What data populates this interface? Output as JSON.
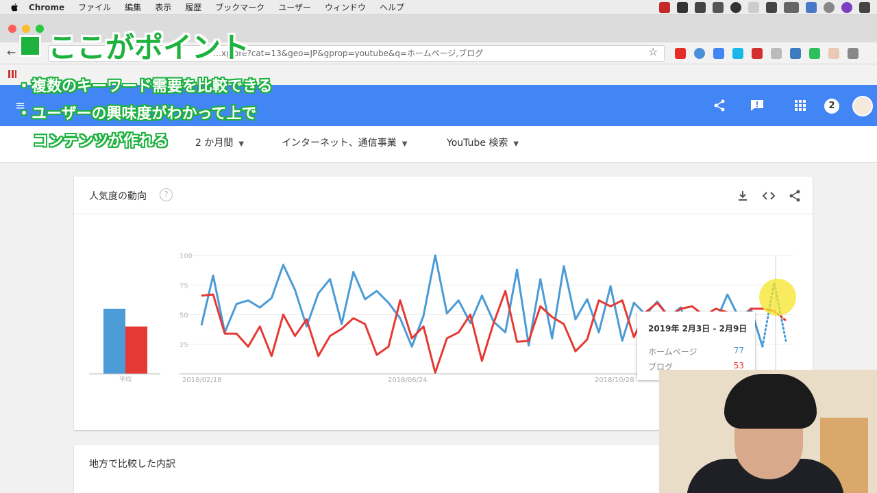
{
  "menubar": {
    "app": "Chrome",
    "items": [
      "ファイル",
      "編集",
      "表示",
      "履歴",
      "ブックマーク",
      "ユーザー",
      "ウィンドウ",
      "ヘルプ"
    ]
  },
  "browser": {
    "url": "…xplore?cat=13&geo=JP&gprop=youtube&q=ホームページ,ブログ"
  },
  "filters": [
    {
      "label": "2 か月間"
    },
    {
      "label": "インターネット、通信事業"
    },
    {
      "label": "YouTube 検索"
    }
  ],
  "header": {
    "notifications": "2"
  },
  "card": {
    "title": "人気度の動向",
    "help": "?"
  },
  "card2": {
    "title": "地方で比較した内訳"
  },
  "tooltip": {
    "date": "2019年 2月3日 - 2月9日",
    "rows": [
      {
        "name": "ホームページ",
        "value": "77",
        "color": "#4a9bd6"
      },
      {
        "name": "ブログ",
        "value": "53",
        "color": "#e53935"
      }
    ]
  },
  "overlay": {
    "title": "ここがポイント",
    "bullets": [
      "・複数のキーワード需要を比較できる",
      "・ユーザーの興味度がわかって上で",
      "コンテンツが作れる"
    ]
  },
  "colors": {
    "blue": "#4a9bd6",
    "red": "#e53935",
    "header": "#4285f4",
    "accent": "#1db13e"
  },
  "chart_data": {
    "type": "line",
    "average": {
      "label": "平均",
      "values": [
        55,
        40
      ]
    },
    "x_ticks": [
      "2018/02/18",
      "2018/06/24",
      "2018/10/28"
    ],
    "y_ticks": [
      100,
      75,
      50,
      25
    ],
    "ylim": [
      0,
      100
    ],
    "series": [
      {
        "name": "ホームページ",
        "color": "#4a9bd6",
        "values": [
          41,
          83,
          35,
          59,
          62,
          56,
          64,
          92,
          71,
          40,
          68,
          80,
          42,
          86,
          63,
          70,
          60,
          47,
          23,
          49,
          100,
          51,
          62,
          43,
          66,
          44,
          35,
          88,
          24,
          80,
          30,
          91,
          46,
          63,
          35,
          74,
          28,
          60,
          50,
          61,
          48,
          56,
          27,
          50,
          44,
          67,
          47,
          55,
          23,
          77,
          28
        ]
      },
      {
        "name": "ブログ",
        "color": "#e53935",
        "values": [
          66,
          67,
          34,
          34,
          23,
          40,
          15,
          50,
          32,
          46,
          15,
          32,
          38,
          47,
          42,
          16,
          23,
          62,
          30,
          40,
          1,
          30,
          35,
          50,
          11,
          43,
          70,
          27,
          28,
          57,
          48,
          42,
          19,
          29,
          62,
          57,
          62,
          31,
          52,
          60,
          48,
          55,
          57,
          49,
          55,
          52,
          38,
          55,
          55,
          53,
          45
        ]
      }
    ]
  }
}
